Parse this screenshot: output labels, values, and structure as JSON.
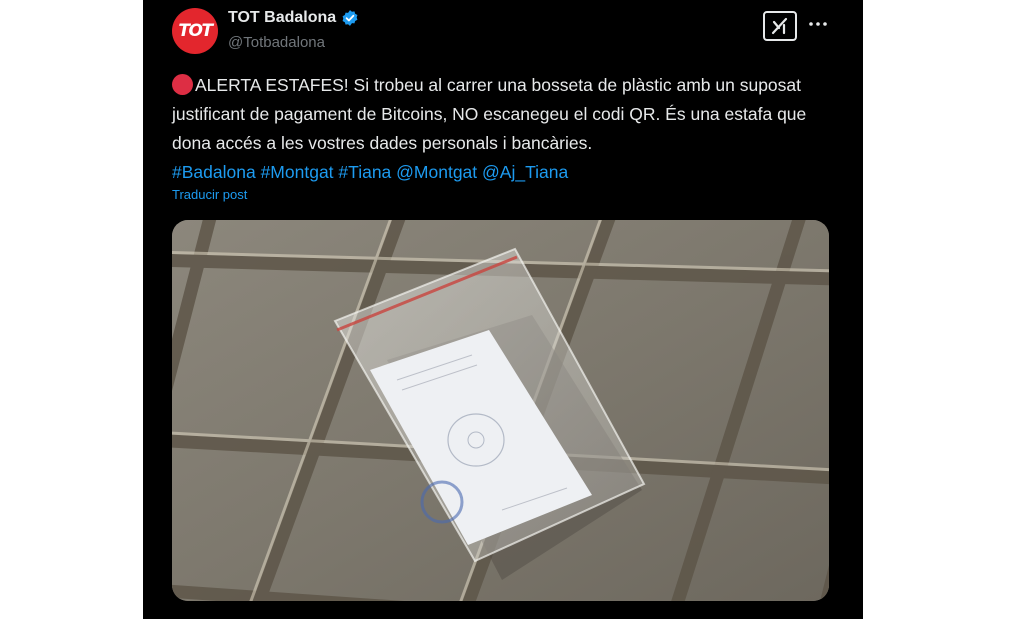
{
  "author": {
    "display_name": "TOT Badalona",
    "handle": "@Totbadalona",
    "avatar_text": "TOT",
    "verified": true
  },
  "header_icons": [
    "grok-icon",
    "more-icon"
  ],
  "tweet": {
    "text_main": "ALERTA ESTAFES! Si trobeu al carrer una bosseta de plàstic amb un suposat justificant de pagament de Bitcoins, NO escanegeu el codi QR. És una estafa que dona accés a les vostres dades personals i bancàries.",
    "tags": [
      "#Badalona",
      "#Montgat",
      "#Tiana",
      "@Montgat",
      "@Aj_Tiana"
    ],
    "translate_label": "Traducir post"
  },
  "media": {
    "image_kind": "photo"
  },
  "colors": {
    "background": "#000000",
    "text": "#e7e9ea",
    "secondary": "#71767b",
    "link": "#1d9bf0",
    "brand_red": "#e3262d",
    "alert_red": "#dd2e44"
  }
}
